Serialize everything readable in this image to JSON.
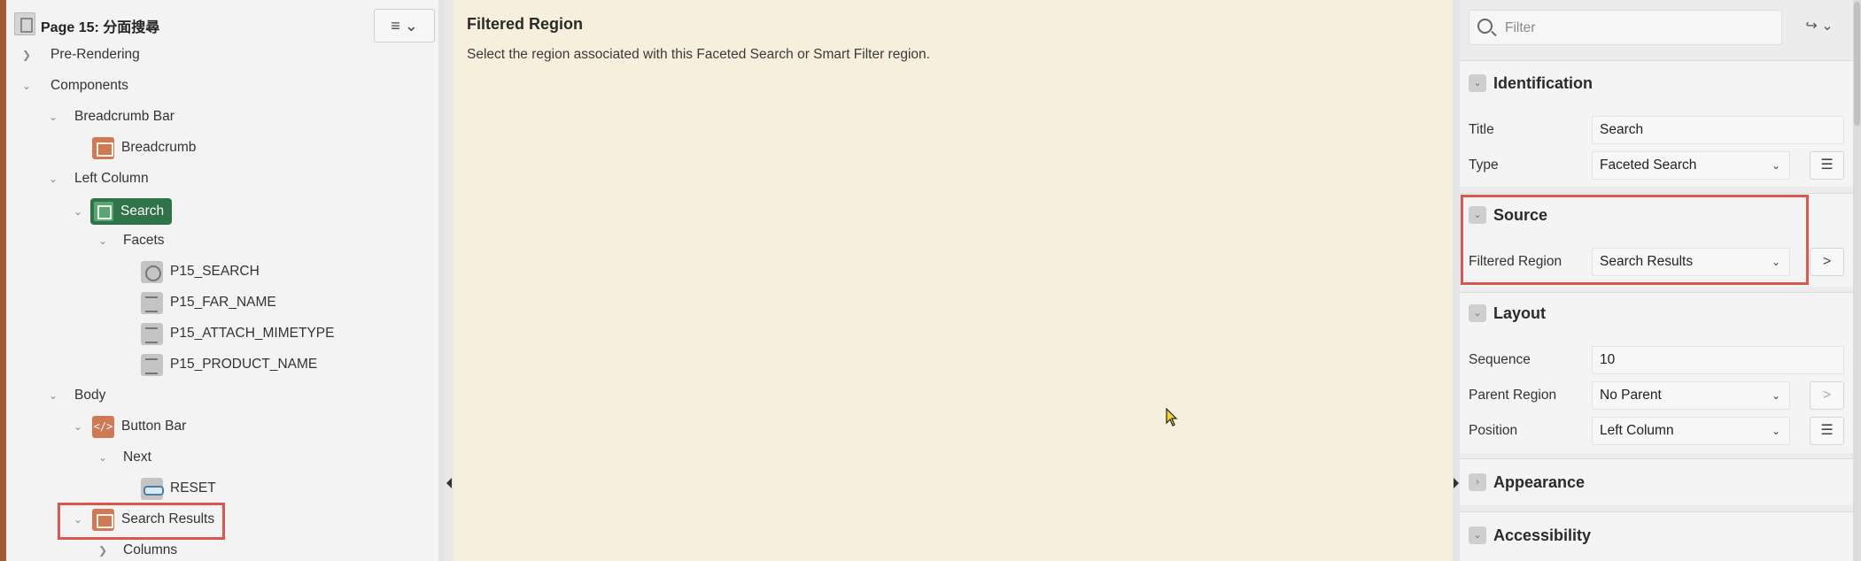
{
  "tree": {
    "page_title": "Page 15: 分面搜尋",
    "menu_button": "≡ ⌄",
    "nodes": [
      {
        "label": "Pre-Rendering"
      },
      {
        "label": "Components"
      },
      {
        "label": "Breadcrumb Bar"
      },
      {
        "label": "Breadcrumb"
      },
      {
        "label": "Left Column"
      },
      {
        "label": "Search"
      },
      {
        "label": "Facets"
      },
      {
        "label": "P15_SEARCH"
      },
      {
        "label": "P15_FAR_NAME"
      },
      {
        "label": "P15_ATTACH_MIMETYPE"
      },
      {
        "label": "P15_PRODUCT_NAME"
      },
      {
        "label": "Body"
      },
      {
        "label": "Button Bar"
      },
      {
        "label": "Next"
      },
      {
        "label": "RESET"
      },
      {
        "label": "Search Results"
      },
      {
        "label": "Columns"
      }
    ],
    "code_icon": "</>"
  },
  "help": {
    "title": "Filtered Region",
    "text": "Select the region associated with this Faceted Search or Smart Filter region."
  },
  "properties": {
    "filter_placeholder": "Filter",
    "go_button": "↪ ⌄",
    "identification": {
      "title": "Identification",
      "title_label": "Title",
      "title_value": "Search",
      "type_label": "Type",
      "type_value": "Faceted Search"
    },
    "source": {
      "title": "Source",
      "filtered_region_label": "Filtered Region",
      "filtered_region_value": "Search Results"
    },
    "layout": {
      "title": "Layout",
      "sequence_label": "Sequence",
      "sequence_value": "10",
      "parent_region_label": "Parent Region",
      "parent_region_value": "No Parent",
      "position_label": "Position",
      "position_value": "Left Column"
    },
    "appearance": {
      "title": "Appearance"
    },
    "accessibility": {
      "title": "Accessibility"
    }
  },
  "icons": {
    "chevron_right": "›",
    "chevron_down": "⌄",
    "list": "☰",
    "arrow_right": ">"
  },
  "colors": {
    "selected_node": "#2f7348",
    "highlight_box": "#d9574e",
    "help_background": "#f6efdc",
    "accent_strip": "#a3592f"
  }
}
